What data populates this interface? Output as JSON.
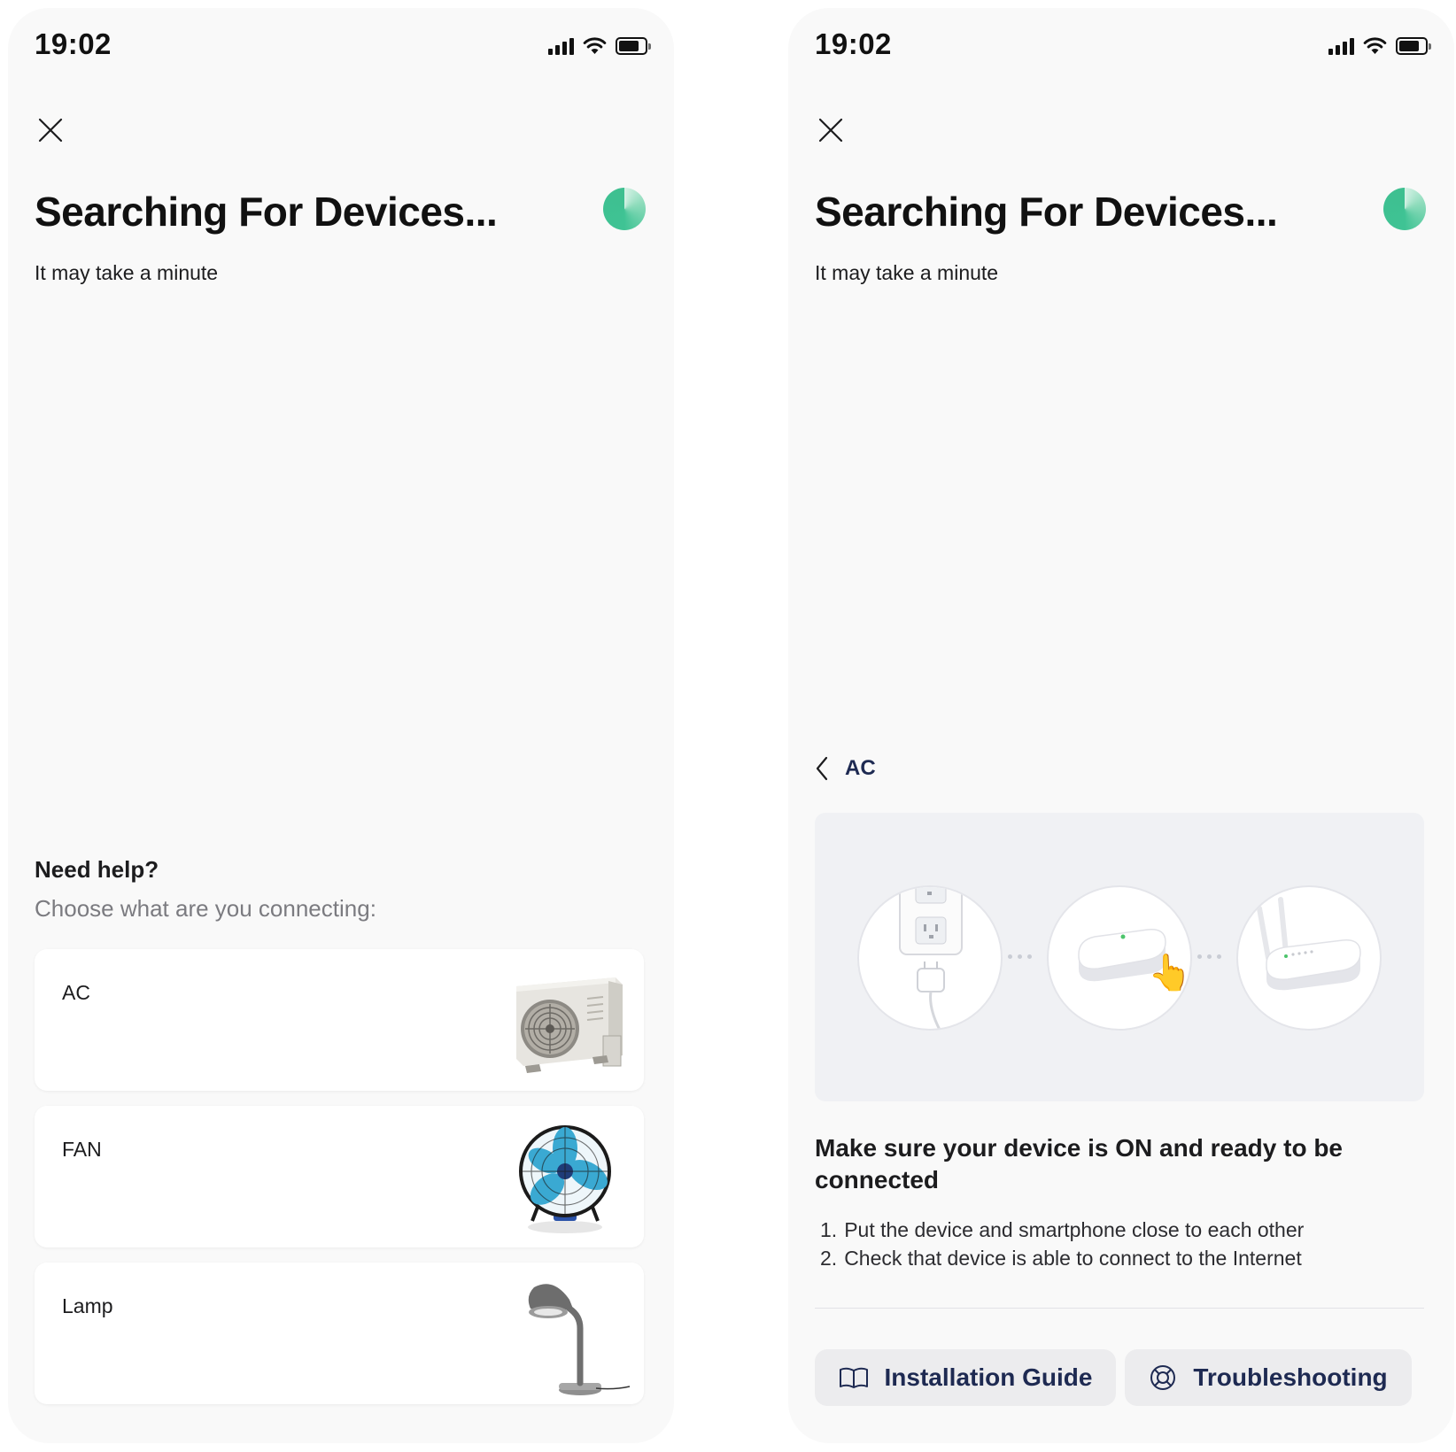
{
  "screens": {
    "left": {
      "status": {
        "time": "19:02"
      },
      "title": "Searching For Devices...",
      "subtitle": "It may take a minute",
      "help": {
        "title": "Need help?",
        "subtitle": "Choose what are you connecting:",
        "devices": [
          {
            "label": "AC",
            "icon": "air-conditioner-icon"
          },
          {
            "label": "FAN",
            "icon": "fan-icon"
          },
          {
            "label": "Lamp",
            "icon": "desk-lamp-icon"
          }
        ]
      }
    },
    "right": {
      "status": {
        "time": "19:02"
      },
      "title": "Searching For Devices...",
      "subtitle": "It may take a minute",
      "back_label": "AC",
      "instructions": {
        "title": "Make sure your device is ON and ready to be connected",
        "steps": [
          {
            "num": "1.",
            "text": "Put the device and smartphone close to each other"
          },
          {
            "num": "2.",
            "text": "Check that device is able to connect to the Internet"
          }
        ]
      },
      "buttons": {
        "guide": "Installation Guide",
        "troubleshooting": "Troubleshooting"
      }
    }
  },
  "colors": {
    "accent_green": "#3fc394",
    "button_text": "#1e2a52",
    "background": "#f9f9f9"
  }
}
